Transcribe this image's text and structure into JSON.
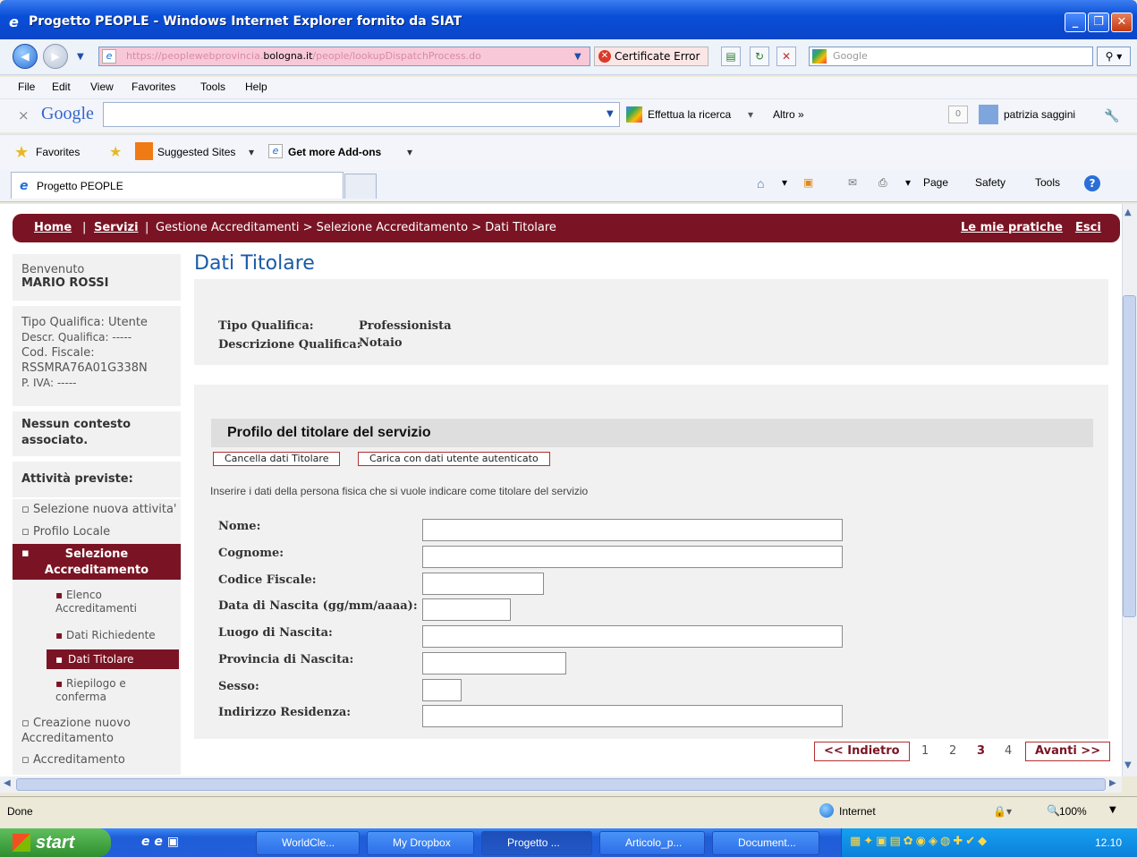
{
  "window": {
    "title": "Progetto PEOPLE - Windows Internet Explorer fornito da SIAT"
  },
  "address": {
    "domain": "bologna.it",
    "url_prefix": "https://peoplewebprovincia.",
    "url_suffix": "/people/lookupDispatchProcess.do",
    "cert": "Certificate Error",
    "search_placeholder": "Google"
  },
  "menu": [
    "File",
    "Edit",
    "View",
    "Favorites",
    "Tools",
    "Help"
  ],
  "google_bar": {
    "logo": "Google",
    "search_btn": "Effettua la ricerca",
    "altro": "Altro »",
    "counter": "0",
    "user": "patrizia saggini"
  },
  "favbar": {
    "favorites": "Favorites",
    "suggested": "Suggested Sites",
    "addons": "Get more Add-ons"
  },
  "tab": {
    "label": "Progetto PEOPLE"
  },
  "commandbar": {
    "page": "Page",
    "safety": "Safety",
    "tools": "Tools"
  },
  "nav": {
    "home": "Home",
    "servizi": "Servizi",
    "crumbs": "Gestione Accreditamenti > Selezione Accreditamento > Dati Titolare",
    "mie_pratiche": "Le mie pratiche",
    "esci": "Esci"
  },
  "sidebar": {
    "welcome": "Benvenuto",
    "user": "MARIO ROSSI",
    "info": [
      "Tipo Qualifica: Utente",
      "Descr. Qualifica: -----",
      "Cod. Fiscale:",
      "RSSMRA76A01G338N",
      "P. IVA: -----"
    ],
    "context": "Nessun contesto associato.",
    "activities_title": "Attività previste:",
    "items": [
      "Selezione nuova attivita'",
      "Profilo Locale",
      "Selezione Accreditamento",
      "Elenco Accreditamenti",
      "Dati Richiedente",
      "Dati Titolare",
      "Riepilogo e conferma",
      "Creazione nuovo Accreditamento",
      "Accreditamento"
    ]
  },
  "main": {
    "title": "Dati Titolare",
    "tipo_label": "Tipo Qualifica:",
    "tipo_value": "Professionista",
    "descr_label": "Descrizione Qualifica:",
    "descr_value": "Notaio",
    "section_title": "Profilo del titolare del servizio",
    "btn_cancella": "Cancella dati Titolare",
    "btn_carica": "Carica con dati utente autenticato",
    "instructions": "Inserire i dati della persona fisica che si vuole indicare come titolare del servizio",
    "fields": [
      {
        "label": "Nome:",
        "value": ""
      },
      {
        "label": "Cognome:",
        "value": ""
      },
      {
        "label": "Codice Fiscale:",
        "value": ""
      },
      {
        "label": "Data di Nascita (gg/mm/aaaa):",
        "value": ""
      },
      {
        "label": "Luogo di Nascita:",
        "value": ""
      },
      {
        "label": "Provincia di Nascita:",
        "value": ""
      },
      {
        "label": "Sesso:",
        "value": ""
      },
      {
        "label": "Indirizzo Residenza:",
        "value": ""
      }
    ],
    "pager": {
      "prev": "<< Indietro",
      "pages": [
        "1",
        "2",
        "3",
        "4"
      ],
      "current": "3",
      "next": "Avanti >>"
    }
  },
  "status": {
    "text": "Done",
    "zone": "Internet",
    "zoom": "100%"
  },
  "taskbar": {
    "start": "start",
    "tasks": [
      "WorldCle...",
      "My Dropbox",
      "Progetto ...",
      "Articolo_p...",
      "Document..."
    ],
    "clock": "12.10"
  }
}
